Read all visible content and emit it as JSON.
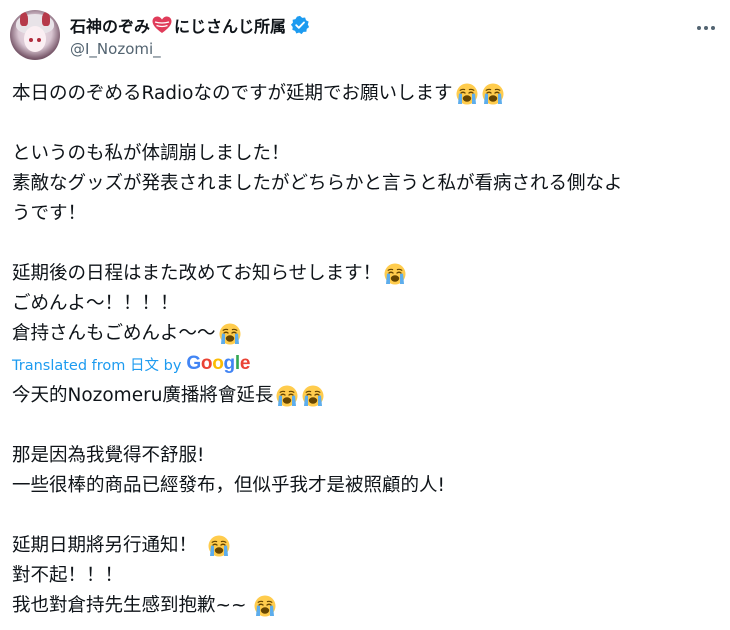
{
  "user": {
    "display_name_part1": "石神のぞみ",
    "display_name_part2": "にじさんじ所属",
    "handle": "@I_Nozomi_"
  },
  "icons": {
    "heart": "heart-emoji-icon",
    "verified": "verified-badge-icon",
    "more": "more-options-icon",
    "emoji": "loudly-crying-face-emoji"
  },
  "original_text": [
    "本日ののぞめるRadioなのですが延期でお願いします",
    "",
    "というのも私が体調崩しました！",
    "素敵なグッズが発表されましたがどちらかと言うと私が看病される側なよ",
    "うです！",
    "",
    "延期後の日程はまた改めてお知らせします！",
    "ごめんよ〜！！！！",
    "倉持さんもごめんよ〜〜"
  ],
  "translation_label": "Translated from 日文 by",
  "translation_provider": "Google",
  "translated_text": [
    "今天的Nozomeru廣播將會延長",
    "",
    "那是因為我覺得不舒服!",
    "一些很棒的商品已經發布，但似乎我才是被照顧的人!",
    "",
    "延期日期將另行通知！",
    "對不起！！！",
    "我也對倉持先生感到抱歉~~"
  ],
  "colors": {
    "link_blue": "#1d9bf0",
    "secondary_text": "#536471",
    "primary_text": "#0f1419",
    "heart_red": "#e03c5a",
    "google_blue": "#4285F4",
    "google_red": "#EA4335",
    "google_yellow": "#FBBC05",
    "google_green": "#34A853"
  }
}
